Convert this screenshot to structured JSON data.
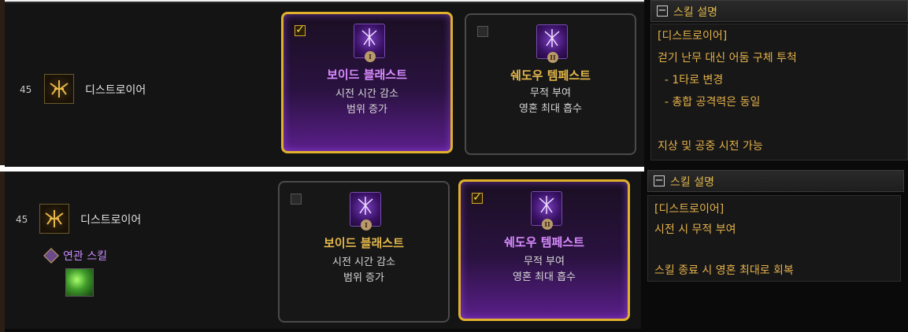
{
  "colors": {
    "accent_gold": "#e0b12a",
    "selected_purple": "#5a1f8a",
    "title_gold": "#e4b84a",
    "selected_title": "#d98cff",
    "desc_text": "#e3b04a"
  },
  "rows": [
    {
      "level": "45",
      "skill_name": "디스트로이어",
      "skill_icon": "destroyer-rune-icon",
      "cards": [
        {
          "title": "보이드 블래스트",
          "lines": [
            "시전 시간 감소",
            "범위 증가"
          ],
          "checked": true,
          "numeral": "I"
        },
        {
          "title": "쉐도우 템페스트",
          "lines": [
            "무적 부여",
            "영혼 최대 흡수"
          ],
          "checked": false,
          "numeral": "II"
        }
      ],
      "description": {
        "header": "스킬 설명",
        "lines": [
          "[디스트로이어]",
          "걷기 난무 대신 어둠 구체 투척",
          "  - 1타로 변경",
          "  - 총합 공격력은 동일",
          "",
          "지상 및 공중 시전 가능"
        ]
      }
    },
    {
      "level": "45",
      "skill_name": "디스트로이어",
      "skill_icon": "destroyer-rune-icon",
      "related_label": "연관 스킬",
      "related_icon": "green-soul-skill-icon",
      "cards": [
        {
          "title": "보이드 블래스트",
          "lines": [
            "시전 시간 감소",
            "범위 증가"
          ],
          "checked": false,
          "numeral": "I"
        },
        {
          "title": "쉐도우 템페스트",
          "lines": [
            "무적 부여",
            "영혼 최대 흡수"
          ],
          "checked": true,
          "numeral": "II"
        }
      ],
      "description": {
        "header": "스킬 설명",
        "lines": [
          "[디스트로이어]",
          "시전 시 무적 부여",
          "",
          "스킬 종료 시 영혼 최대로 회복"
        ]
      }
    }
  ]
}
